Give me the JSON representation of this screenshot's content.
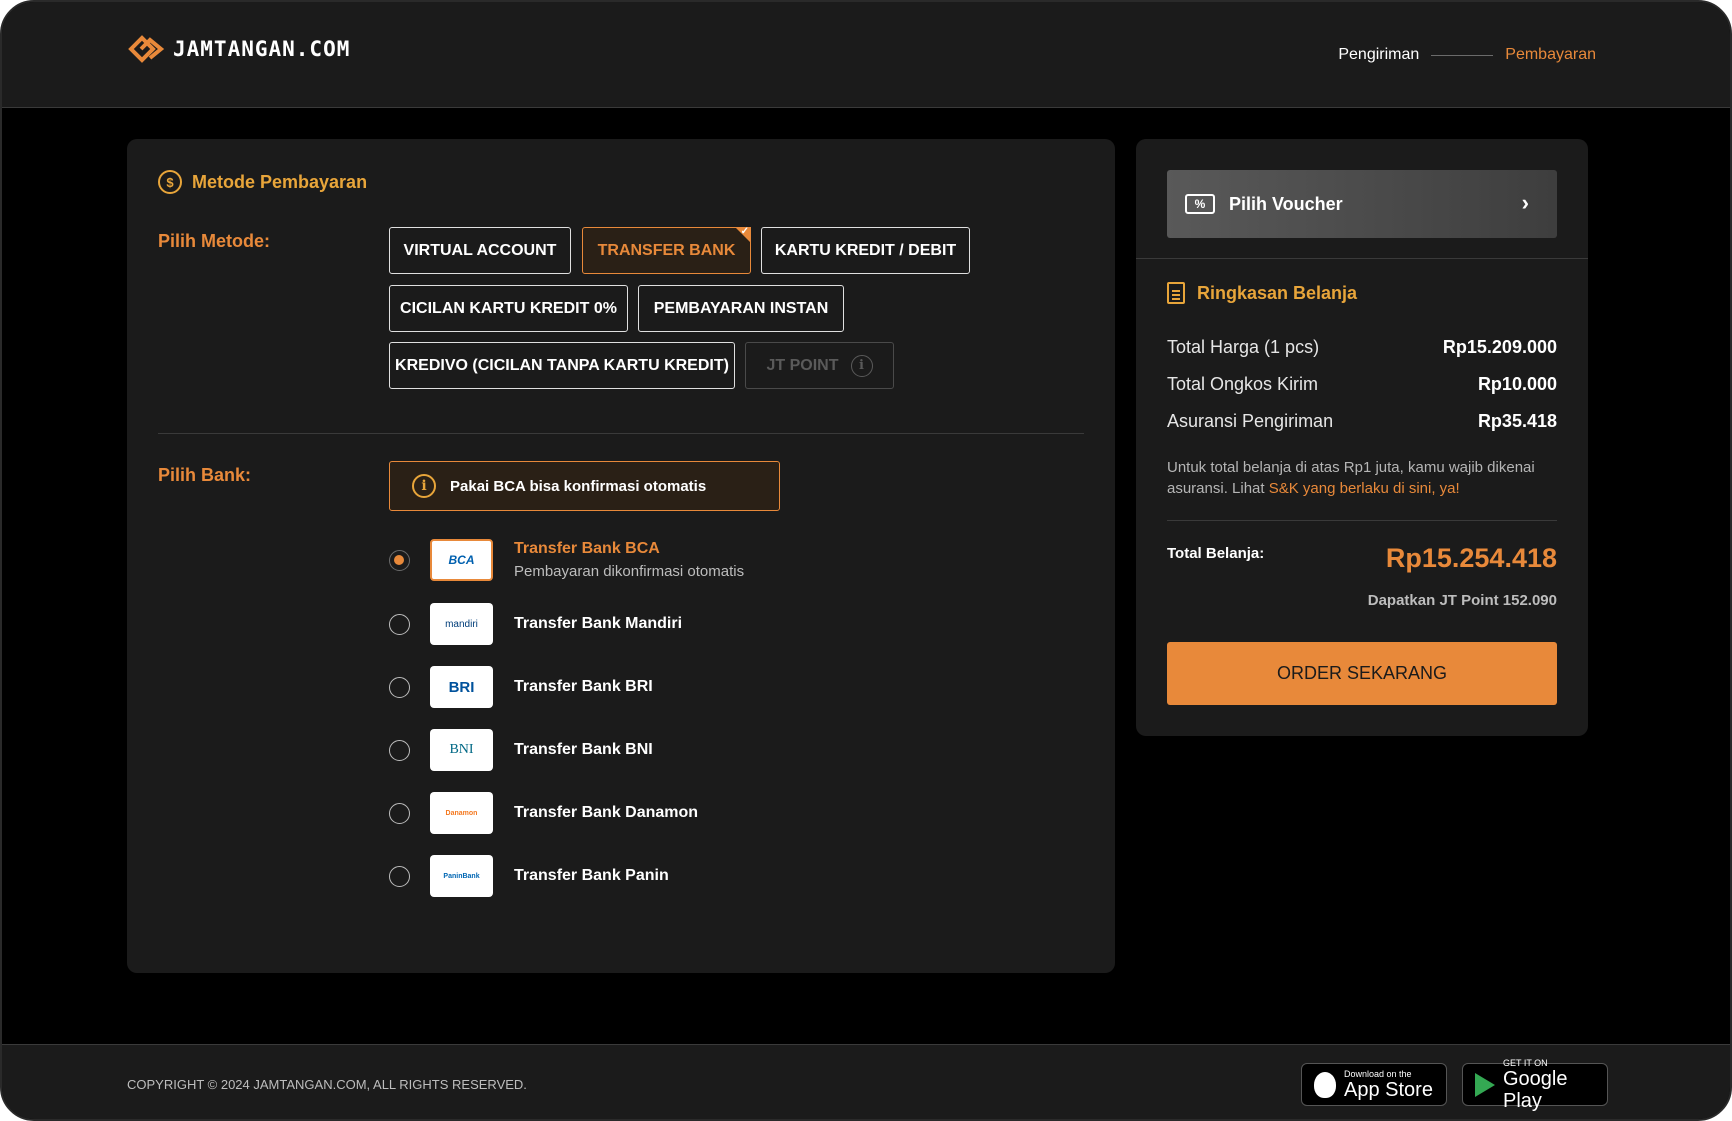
{
  "header": {
    "logo_text": "JAMTANGAN.COM",
    "steps": [
      "Pengiriman",
      "Pembayaran"
    ]
  },
  "payment": {
    "title": "Metode Pembayaran",
    "method_label": "Pilih Metode:",
    "methods": [
      {
        "label": "VIRTUAL ACCOUNT",
        "state": "default"
      },
      {
        "label": "TRANSFER BANK",
        "state": "selected"
      },
      {
        "label": "KARTU KREDIT / DEBIT",
        "state": "default"
      },
      {
        "label": "CICILAN KARTU KREDIT 0%",
        "state": "default"
      },
      {
        "label": "PEMBAYARAN INSTAN",
        "state": "default"
      },
      {
        "label": "KREDIVO (CICILAN TANPA KARTU KREDIT)",
        "state": "default"
      },
      {
        "label": "JT POINT",
        "state": "disabled"
      }
    ],
    "bank_label": "Pilih Bank:",
    "notice": "Pakai BCA bisa konfirmasi otomatis",
    "banks": [
      {
        "name": "Transfer Bank BCA",
        "sub": "Pembayaran dikonfirmasi otomatis",
        "logo": "BCA",
        "logo_color": "#0060af",
        "selected": true
      },
      {
        "name": "Transfer Bank Mandiri",
        "sub": "",
        "logo": "mandiri",
        "logo_color": "#003d79",
        "selected": false
      },
      {
        "name": "Transfer Bank BRI",
        "sub": "",
        "logo": "BRI",
        "logo_color": "#00529c",
        "selected": false
      },
      {
        "name": "Transfer Bank BNI",
        "sub": "",
        "logo": "BNI",
        "logo_color": "#006885",
        "selected": false
      },
      {
        "name": "Transfer Bank Danamon",
        "sub": "",
        "logo": "Danamon",
        "logo_color": "#f47920",
        "selected": false
      },
      {
        "name": "Transfer Bank Panin",
        "sub": "",
        "logo": "PaninBank",
        "logo_color": "#0066b3",
        "selected": false
      }
    ]
  },
  "summary": {
    "voucher_label": "Pilih Voucher",
    "title": "Ringkasan Belanja",
    "rows": [
      {
        "label": "Total Harga (1 pcs)",
        "value": "Rp15.209.000"
      },
      {
        "label": "Total Ongkos Kirim",
        "value": "Rp10.000"
      },
      {
        "label": "Asuransi Pengiriman",
        "value": "Rp35.418"
      }
    ],
    "insurance_note": "Untuk total belanja di atas Rp1 juta, kamu wajib dikenai asuransi. Lihat ",
    "insurance_link": "S&K yang berlaku di sini, ya!",
    "total_label": "Total Belanja:",
    "total_value": "Rp15.254.418",
    "point_text": "Dapatkan JT Point 152.090",
    "order_button": "ORDER SEKARANG"
  },
  "footer": {
    "copyright": "COPYRIGHT © 2024 JAMTANGAN.COM, ALL RIGHTS RESERVED.",
    "app_store_small": "Download on the",
    "app_store_big": "App Store",
    "google_play_small": "GET IT ON",
    "google_play_big": "Google Play"
  },
  "colors": {
    "accent": "#e8893a",
    "accent_title": "#e8a53a",
    "panel": "#1b1b1b",
    "background": "#000000"
  },
  "icons": [
    "logo-icon",
    "dollar-icon",
    "info-icon",
    "voucher-icon",
    "chevron-right-icon",
    "document-icon",
    "apple-icon",
    "google-play-icon"
  ]
}
